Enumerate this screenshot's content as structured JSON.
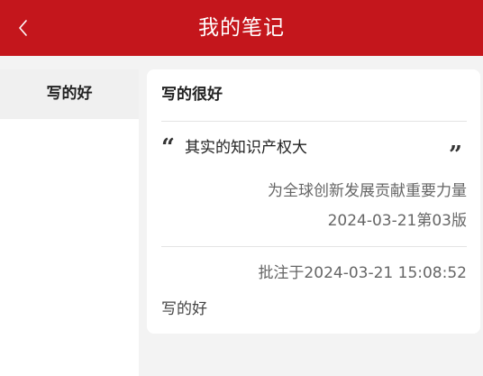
{
  "header": {
    "title": "我的笔记",
    "back_icon": "chevron-left-icon",
    "background_color": "#c4161c"
  },
  "sidebar": {
    "items": [
      {
        "label": "写的好",
        "selected": true
      }
    ]
  },
  "note_card": {
    "title": "写的很好",
    "quote_open": "“",
    "quote_close": "”",
    "quote_text": "其实的知识产权大",
    "source_title": "为全球创新发展贡献重要力量",
    "source_date": "2024-03-21第03版",
    "annotation_time": "批注于2024-03-21 15:08:52",
    "note_text": "写的好"
  }
}
